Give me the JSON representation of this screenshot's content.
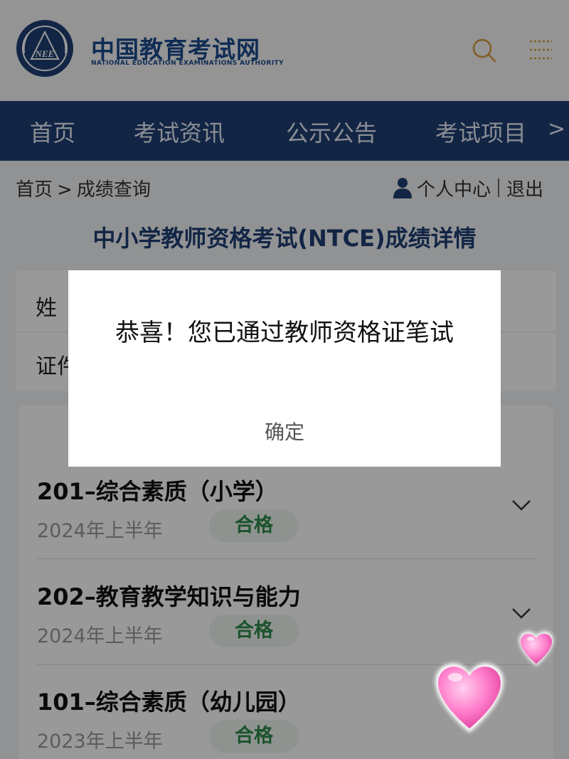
{
  "header": {
    "logo_emblem_text": "NEE",
    "logo_cn": "中国教育考试网",
    "logo_en": "NATIONAL EDUCATION EXAMINATIONS AUTHORITY",
    "search_icon": "search-icon",
    "menu_icon": "menu-icon"
  },
  "nav": {
    "items": [
      "首页",
      "考试资讯",
      "公示公告",
      "考试项目"
    ],
    "more": ">"
  },
  "breadcrumb": {
    "home": "首页",
    "separator": ">",
    "current": "成绩查询"
  },
  "user": {
    "center": "个人中心",
    "logout": "退出"
  },
  "page_title": "中小学教师资格考试(NTCE)成绩详情",
  "info": {
    "row1_label": "姓",
    "row2_label": "证件"
  },
  "results": [
    {
      "title": "201–综合素质（小学）",
      "date": "2024年上半年",
      "status": "合格"
    },
    {
      "title": "202–教育教学知识与能力",
      "date": "2024年上半年",
      "status": "合格"
    },
    {
      "title": "101–综合素质（幼儿园）",
      "date": "2023年上半年",
      "status": "合格"
    }
  ],
  "modal": {
    "message": "恭喜！您已通过教师资格证笔试",
    "confirm": "确定"
  },
  "colors": {
    "brand": "#1e3f73",
    "pass": "#2e8b4a",
    "search_accent": "#d79a3e"
  }
}
